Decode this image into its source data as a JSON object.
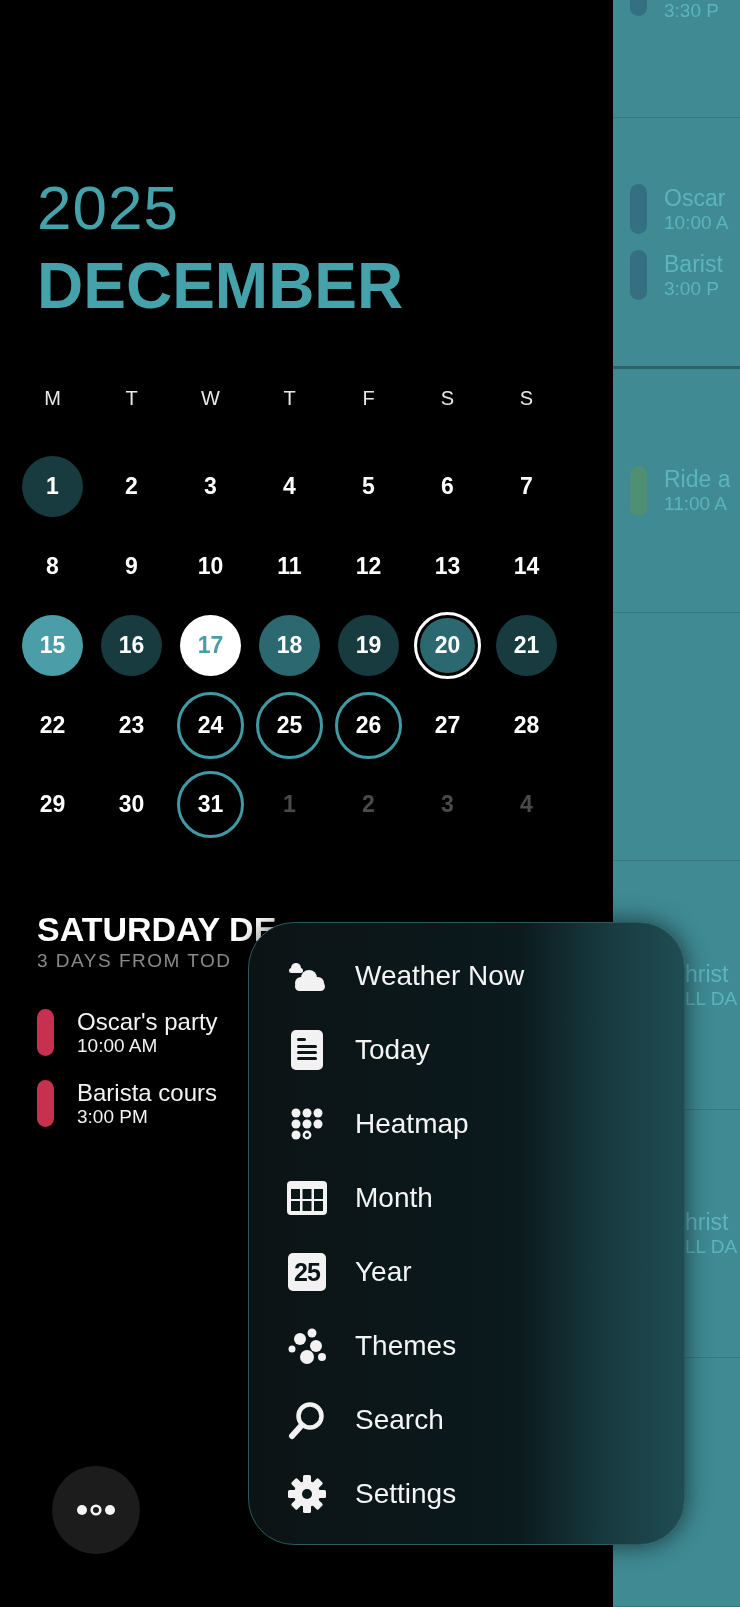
{
  "header": {
    "year": "2025",
    "month": "DECEMBER"
  },
  "calendar": {
    "weekdays": [
      "M",
      "T",
      "W",
      "T",
      "F",
      "S",
      "S"
    ],
    "days": [
      {
        "label": "1",
        "kind": "dark",
        "selected": false
      },
      {
        "label": "2",
        "kind": "plain",
        "selected": false
      },
      {
        "label": "3",
        "kind": "plain",
        "selected": false
      },
      {
        "label": "4",
        "kind": "plain",
        "selected": false
      },
      {
        "label": "5",
        "kind": "plain",
        "selected": false
      },
      {
        "label": "6",
        "kind": "plain",
        "selected": false
      },
      {
        "label": "7",
        "kind": "plain",
        "selected": false
      },
      {
        "label": "8",
        "kind": "plain",
        "selected": false
      },
      {
        "label": "9",
        "kind": "plain",
        "selected": false
      },
      {
        "label": "10",
        "kind": "plain",
        "selected": false
      },
      {
        "label": "11",
        "kind": "plain",
        "selected": false
      },
      {
        "label": "12",
        "kind": "plain",
        "selected": false
      },
      {
        "label": "13",
        "kind": "plain",
        "selected": false
      },
      {
        "label": "14",
        "kind": "plain",
        "selected": false
      },
      {
        "label": "15",
        "kind": "teal",
        "selected": false
      },
      {
        "label": "16",
        "kind": "dark",
        "selected": false
      },
      {
        "label": "17",
        "kind": "today",
        "selected": false
      },
      {
        "label": "18",
        "kind": "medium",
        "selected": false
      },
      {
        "label": "19",
        "kind": "dark",
        "selected": false
      },
      {
        "label": "20",
        "kind": "medium",
        "selected": true
      },
      {
        "label": "21",
        "kind": "dark",
        "selected": false
      },
      {
        "label": "22",
        "kind": "plain",
        "selected": false
      },
      {
        "label": "23",
        "kind": "plain",
        "selected": false
      },
      {
        "label": "24",
        "kind": "ring",
        "selected": false
      },
      {
        "label": "25",
        "kind": "ring",
        "selected": false
      },
      {
        "label": "26",
        "kind": "ring",
        "selected": false
      },
      {
        "label": "27",
        "kind": "plain",
        "selected": false
      },
      {
        "label": "28",
        "kind": "plain",
        "selected": false
      },
      {
        "label": "29",
        "kind": "plain",
        "selected": false
      },
      {
        "label": "30",
        "kind": "plain",
        "selected": false
      },
      {
        "label": "31",
        "kind": "ring",
        "selected": false
      },
      {
        "label": "1",
        "kind": "outside",
        "selected": false
      },
      {
        "label": "2",
        "kind": "outside",
        "selected": false
      },
      {
        "label": "3",
        "kind": "outside",
        "selected": false
      },
      {
        "label": "4",
        "kind": "outside",
        "selected": false
      }
    ]
  },
  "agenda": {
    "title": "SATURDAY DE",
    "subtitle": "3 DAYS FROM TOD",
    "events": [
      {
        "title": "Oscar's party",
        "time": "10:00 AM",
        "color": "#c8304f"
      },
      {
        "title": "Barista cours",
        "time": "3:00 PM",
        "color": "#c8304f"
      }
    ]
  },
  "side_panel": {
    "sections": [
      {
        "events": [
          {
            "kind": "bar",
            "time": "3:30 P",
            "color": "#356f82"
          }
        ]
      },
      {
        "events": [
          {
            "kind": "bar",
            "title": "Oscar",
            "time": "10:00 A",
            "color": "#356f82"
          },
          {
            "kind": "bar",
            "title": "Barist",
            "time": "3:00 P",
            "color": "#356f82"
          }
        ]
      },
      {
        "events": [
          {
            "kind": "bar",
            "title": "Ride a",
            "time": "11:00 A",
            "color": "#4f8f72"
          }
        ]
      },
      {
        "events": [
          {
            "kind": "covered",
            "title": "hrist",
            "time": "LL DA"
          }
        ]
      },
      {
        "events": [
          {
            "kind": "covered",
            "title": "hrist",
            "time": "LL DA"
          }
        ]
      }
    ]
  },
  "menu": {
    "items": [
      {
        "label": "Weather Now"
      },
      {
        "label": "Today"
      },
      {
        "label": "Heatmap"
      },
      {
        "label": "Month"
      },
      {
        "label": "Year",
        "icon_text": "25"
      },
      {
        "label": "Themes"
      },
      {
        "label": "Search"
      },
      {
        "label": "Settings"
      }
    ]
  }
}
